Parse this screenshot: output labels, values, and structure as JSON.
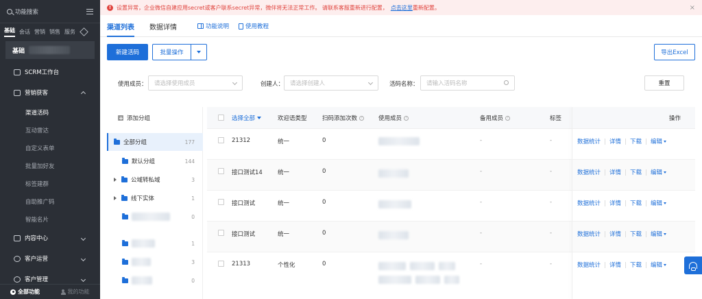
{
  "sidebar": {
    "search_label": "功能搜索",
    "tabs": [
      {
        "label": "基础",
        "active": true
      },
      {
        "label": "会话"
      },
      {
        "label": "营销"
      },
      {
        "label": "销售"
      },
      {
        "label": "服务"
      }
    ],
    "section_title": "基础",
    "menu": {
      "scrm": "SCRM工作台",
      "marketing": "营销获客",
      "content": "内容中心",
      "ops": "客户运营",
      "manage": "客户管理"
    },
    "submenu": [
      "渠道活码",
      "互动雷达",
      "自定义表单",
      "批量加好友",
      "标签建群",
      "自助推广码",
      "智能名片"
    ],
    "footer": {
      "all": "全部功能",
      "mine": "我的功能"
    }
  },
  "banner": {
    "text": "设置异常，企业微信自建应用secret或客户联系secret异常，微伴将无法正常工作。 请联系客服重新进行配置，",
    "link": "点击这里",
    "tail": "重新配置。",
    "close": "×"
  },
  "tabs": {
    "list": "渠道列表",
    "detail": "数据详情",
    "help": "功能说明",
    "tutorial": "使用教程"
  },
  "toolbar": {
    "new": "新建活码",
    "batch": "批量操作",
    "export": "导出Excel"
  },
  "filters": {
    "member_label": "使用成员：",
    "member_placeholder": "请选择使用成员",
    "creator_label": "创建人：",
    "creator_placeholder": "请选择创建人",
    "name_label": "活码名称：",
    "name_placeholder": "请输入活码名称",
    "reset": "重置"
  },
  "tree": {
    "add": "添加分组",
    "items": [
      {
        "label": "全部分组",
        "count": "177"
      },
      {
        "label": "默认分组",
        "count": "144"
      },
      {
        "label": "公域转私域",
        "count": "3"
      },
      {
        "label": "线下实体",
        "count": "1"
      },
      {
        "count": "0"
      },
      {
        "count": "1"
      },
      {
        "count": "3"
      },
      {
        "count": "0"
      }
    ]
  },
  "table": {
    "headers": {
      "select": "选择全部",
      "welcome": "欢迎语类型",
      "scans": "扫码添加次数",
      "members": "使用成员",
      "backup": "备用成员",
      "tags": "标签",
      "ops": "操作"
    },
    "rows": [
      {
        "name": "21312",
        "type": "统一",
        "scans": "0",
        "backup": "-",
        "tags": "-"
      },
      {
        "name": "接口测试14",
        "type": "统一",
        "scans": "0",
        "backup": "-",
        "tags": "-"
      },
      {
        "name": "接口测试",
        "type": "统一",
        "scans": "0",
        "backup": "-",
        "tags": "-"
      },
      {
        "name": "接口测试",
        "type": "统一",
        "scans": "0",
        "backup": "-",
        "tags": "-"
      },
      {
        "name": "21313",
        "type": "个性化",
        "scans": "0",
        "backup": "-",
        "tags": "-"
      }
    ],
    "ops": {
      "stats": "数据统计",
      "detail": "详情",
      "download": "下载",
      "edit": "编辑"
    }
  }
}
